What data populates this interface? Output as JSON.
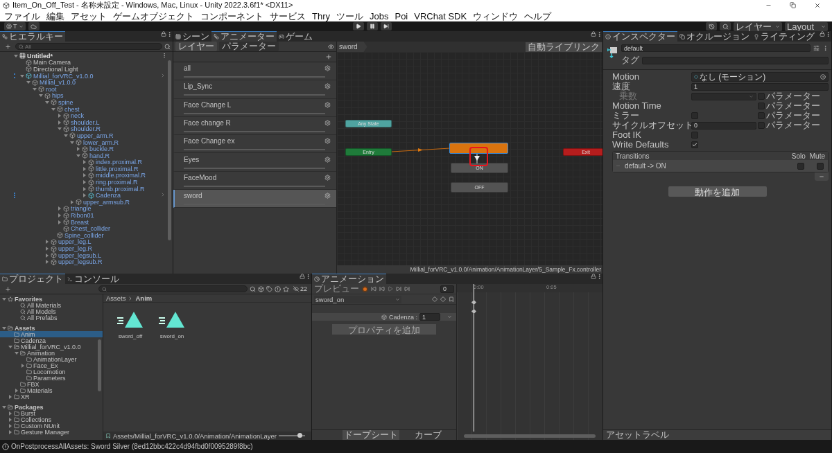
{
  "window": {
    "title": "Item_On_Off_Test - 名称未設定 - Windows, Mac, Linux - Unity 2022.3.6f1* <DX11>"
  },
  "menu": [
    "ファイル",
    "編集",
    "アセット",
    "ゲームオブジェクト",
    "コンポーネント",
    "サービス",
    "Thry",
    "ツール",
    "Jobs",
    "Poi",
    "VRChat SDK",
    "ウィンドウ",
    "ヘルプ"
  ],
  "toolbar": {
    "account": "T",
    "layers": "レイヤー",
    "layout": "Layout"
  },
  "hierarchy": {
    "tab": "ヒエラルキー",
    "search": {
      "placeholder": "All"
    },
    "items": [
      {
        "name": "Untitled*",
        "kind": "scene",
        "expanded": true,
        "prefab": false,
        "selected": false,
        "children": [
          {
            "name": "Main Camera",
            "kind": "object",
            "prefab": false,
            "selected": false
          },
          {
            "name": "Directional Light",
            "kind": "object",
            "prefab": false,
            "selected": false
          },
          {
            "name": "Millial_forVRC_v1.0.0",
            "kind": "prefab-root",
            "expanded": true,
            "prefab": true,
            "selected": false,
            "children": [
              {
                "name": "Millial_v1.0.0",
                "kind": "object",
                "expanded": true,
                "prefab": true,
                "selected": false,
                "children": [
                  {
                    "name": "root",
                    "kind": "object",
                    "expanded": true,
                    "prefab": true,
                    "selected": false,
                    "children": [
                      {
                        "name": "hips",
                        "kind": "object",
                        "expanded": true,
                        "prefab": true,
                        "selected": false,
                        "children": [
                          {
                            "name": "spine",
                            "kind": "object",
                            "expanded": true,
                            "prefab": true,
                            "selected": false,
                            "children": [
                              {
                                "name": "chest",
                                "kind": "object",
                                "expanded": true,
                                "prefab": true,
                                "selected": false,
                                "children": [
                                  {
                                    "name": "neck",
                                    "kind": "object",
                                    "expanded": false,
                                    "prefab": true,
                                    "selected": false
                                  },
                                  {
                                    "name": "shoulder.L",
                                    "kind": "object",
                                    "expanded": false,
                                    "prefab": true,
                                    "selected": false
                                  },
                                  {
                                    "name": "shoulder.R",
                                    "kind": "object",
                                    "expanded": true,
                                    "prefab": true,
                                    "selected": false,
                                    "children": [
                                      {
                                        "name": "upper_arm.R",
                                        "kind": "object",
                                        "expanded": true,
                                        "prefab": true,
                                        "selected": false,
                                        "children": [
                                          {
                                            "name": "lower_arm.R",
                                            "kind": "object",
                                            "expanded": true,
                                            "prefab": true,
                                            "selected": false,
                                            "children": [
                                              {
                                                "name": "buckle.R",
                                                "kind": "object",
                                                "expanded": false,
                                                "prefab": true,
                                                "selected": false
                                              },
                                              {
                                                "name": "hand.R",
                                                "kind": "object",
                                                "expanded": true,
                                                "prefab": true,
                                                "selected": false,
                                                "children": [
                                                  {
                                                    "name": "index.proximal.R",
                                                    "kind": "object",
                                                    "expanded": false,
                                                    "prefab": true,
                                                    "selected": false
                                                  },
                                                  {
                                                    "name": "little.proximal.R",
                                                    "kind": "object",
                                                    "expanded": false,
                                                    "prefab": true,
                                                    "selected": false
                                                  },
                                                  {
                                                    "name": "middle.proximal.R",
                                                    "kind": "object",
                                                    "expanded": false,
                                                    "prefab": true,
                                                    "selected": false
                                                  },
                                                  {
                                                    "name": "ring.proximal.R",
                                                    "kind": "object",
                                                    "expanded": false,
                                                    "prefab": true,
                                                    "selected": false
                                                  },
                                                  {
                                                    "name": "thumb.proximal.R",
                                                    "kind": "object",
                                                    "expanded": false,
                                                    "prefab": true,
                                                    "selected": false
                                                  },
                                                  {
                                                    "name": "Cadenza",
                                                    "kind": "prefab-root",
                                                    "expanded": false,
                                                    "prefab": true,
                                                    "selected": false
                                                  }
                                                ]
                                              }
                                            ]
                                          },
                                          {
                                            "name": "upper_armsub.R",
                                            "kind": "object",
                                            "expanded": false,
                                            "prefab": true,
                                            "selected": false
                                          }
                                        ]
                                      }
                                    ]
                                  },
                                  {
                                    "name": "triangle",
                                    "kind": "object",
                                    "expanded": false,
                                    "prefab": true,
                                    "selected": false
                                  },
                                  {
                                    "name": "Ribon01",
                                    "kind": "object",
                                    "expanded": false,
                                    "prefab": true,
                                    "selected": false
                                  },
                                  {
                                    "name": "Breast",
                                    "kind": "object",
                                    "expanded": false,
                                    "prefab": true,
                                    "selected": false
                                  },
                                  {
                                    "name": "Chest_collider",
                                    "kind": "object",
                                    "prefab": true,
                                    "selected": false
                                  }
                                ]
                              },
                              {
                                "name": "Spine_collider",
                                "kind": "object",
                                "prefab": true,
                                "selected": false
                              }
                            ]
                          },
                          {
                            "name": "upper_leg.L",
                            "kind": "object",
                            "expanded": false,
                            "prefab": true,
                            "selected": false
                          },
                          {
                            "name": "upper_leg.R",
                            "kind": "object",
                            "expanded": false,
                            "prefab": true,
                            "selected": false
                          },
                          {
                            "name": "upper_legsub.L",
                            "kind": "object",
                            "expanded": false,
                            "prefab": true,
                            "selected": false
                          },
                          {
                            "name": "upper_legsub.R",
                            "kind": "object",
                            "expanded": false,
                            "prefab": true,
                            "selected": false
                          }
                        ]
                      }
                    ]
                  }
                ]
              }
            ]
          }
        ]
      }
    ]
  },
  "animator": {
    "tabs": [
      {
        "label": "シーン",
        "kind": "scene",
        "selected": false
      },
      {
        "label": "アニメーター",
        "kind": "animator",
        "selected": true
      },
      {
        "label": "ゲーム",
        "kind": "game",
        "selected": false
      }
    ],
    "subtabs": [
      {
        "label": "レイヤー",
        "selected": true
      },
      {
        "label": "パラメーター",
        "selected": false
      }
    ],
    "layers": [
      {
        "name": "all",
        "selected": false
      },
      {
        "name": "Lip_Sync",
        "selected": false
      },
      {
        "name": "Face Change L",
        "selected": false
      },
      {
        "name": "Face change R",
        "selected": false
      },
      {
        "name": "Face Change ex",
        "selected": false
      },
      {
        "name": "Eyes",
        "selected": false
      },
      {
        "name": "FaceMood",
        "selected": false
      },
      {
        "name": "sword",
        "selected": true
      }
    ],
    "breadcrumb": "sword",
    "live_link": "自動ライブリンク",
    "nodes": [
      {
        "kind": "any",
        "label": "Any State"
      },
      {
        "kind": "entry",
        "label": "Entry"
      },
      {
        "kind": "default"
      },
      {
        "kind": "state",
        "label": "ON"
      },
      {
        "kind": "state",
        "label": "OFF"
      },
      {
        "kind": "exit",
        "label": "Exit"
      }
    ],
    "path": "Millial_forVRC_v1.0.0/Animation/AnimationLayer/5_Sample_Fx.controller"
  },
  "inspector": {
    "tabs": [
      {
        "label": "インスペクター",
        "kind": "info",
        "selected": true
      },
      {
        "label": "オクルージョン",
        "kind": "occlusion",
        "selected": false
      },
      {
        "label": "ライティング",
        "kind": "light",
        "selected": false
      }
    ],
    "name": "default",
    "tag_label": "タグ",
    "properties": [
      {
        "kind": "object",
        "label": "Motion",
        "value": "なし (モーション)",
        "disabled": false
      },
      {
        "kind": "number",
        "label": "速度",
        "value": "1",
        "disabled": false
      },
      {
        "kind": "dropdown",
        "label": "乗数",
        "disabled": true,
        "param": {
          "label": "パラメーター",
          "checked": false
        }
      },
      {
        "kind": "empty",
        "label": "Motion Time",
        "disabled": false,
        "param": {
          "label": "パラメーター",
          "checked": false
        }
      },
      {
        "kind": "checkbox",
        "label": "ミラー",
        "checked": false,
        "disabled": false,
        "param": {
          "label": "パラメーター",
          "checked": false
        }
      },
      {
        "kind": "number",
        "label": "サイクルオフセット",
        "value": "0",
        "disabled": false,
        "param": {
          "label": "パラメーター",
          "checked": false
        }
      },
      {
        "kind": "checkbox",
        "label": "Foot IK",
        "checked": false,
        "disabled": false
      },
      {
        "kind": "checkbox",
        "label": "Write Defaults",
        "checked": true,
        "disabled": false
      }
    ],
    "transitions": {
      "title": "Transitions",
      "solo": "Solo",
      "mute": "Mute",
      "rows": [
        {
          "label": "default -> ON",
          "solo": false,
          "mute": false
        }
      ]
    },
    "add_button": "動作を追加",
    "asset_labels": "アセットラベル"
  },
  "project": {
    "tabs": [
      {
        "label": "プロジェクト",
        "kind": "folder",
        "selected": true
      },
      {
        "label": "コンソール",
        "kind": "console",
        "selected": false
      }
    ],
    "hidden_count": "22",
    "tree": [
      {
        "name": "Favorites",
        "kind": "favorites",
        "expanded": true,
        "selected": false,
        "children": [
          {
            "name": "All Materials",
            "kind": "search",
            "selected": false
          },
          {
            "name": "All Models",
            "kind": "search",
            "selected": false
          },
          {
            "name": "All Prefabs",
            "kind": "search",
            "selected": false
          }
        ]
      },
      {
        "name": "Assets",
        "kind": "folder-open",
        "expanded": true,
        "selected": false,
        "children": [
          {
            "name": "Anim",
            "kind": "folder",
            "selected": true
          },
          {
            "name": "Cadenza",
            "kind": "folder",
            "selected": false
          },
          {
            "name": "Millial_forVRC_v1.0.0",
            "kind": "folder-open",
            "expanded": true,
            "selected": false,
            "children": [
              {
                "name": "Animation",
                "kind": "folder-open",
                "expanded": true,
                "selected": false,
                "children": [
                  {
                    "name": "AnimationLayer",
                    "kind": "folder",
                    "selected": false
                  },
                  {
                    "name": "Face_Ex",
                    "kind": "folder",
                    "expanded": false,
                    "selected": false
                  },
                  {
                    "name": "Locomotion",
                    "kind": "folder",
                    "selected": false
                  },
                  {
                    "name": "Parameters",
                    "kind": "folder",
                    "selected": false
                  }
                ]
              },
              {
                "name": "FBX",
                "kind": "folder",
                "selected": false
              },
              {
                "name": "Materials",
                "kind": "folder",
                "expanded": false,
                "selected": false
              }
            ]
          },
          {
            "name": "XR",
            "kind": "folder",
            "expanded": false,
            "selected": false
          }
        ]
      },
      {
        "name": "Packages",
        "kind": "folder-open",
        "expanded": true,
        "selected": false,
        "children": [
          {
            "name": "Burst",
            "kind": "folder",
            "expanded": false,
            "selected": false
          },
          {
            "name": "Collections",
            "kind": "folder",
            "expanded": false,
            "selected": false
          },
          {
            "name": "Custom NUnit",
            "kind": "folder",
            "expanded": false,
            "selected": false
          },
          {
            "name": "Gesture Manager",
            "kind": "folder",
            "expanded": false,
            "selected": false
          }
        ]
      }
    ],
    "breadcrumb": [
      "Assets",
      "Anim"
    ],
    "assets": [
      {
        "name": "sword_off"
      },
      {
        "name": "sword_on"
      }
    ],
    "path": "Assets/Millial_forVRC_v1.0.0/Animation/AnimationLayer",
    "zoom": {
      "level": 0.8
    }
  },
  "animation": {
    "tab": "アニメーション",
    "preview": "プレビュー",
    "frame": "0",
    "clip": "sword_on",
    "properties": [
      {
        "name": "Cadenza :",
        "value": "1"
      }
    ],
    "add_property": "プロパティを追加",
    "modes": [
      {
        "label": "ドープシート",
        "selected": true
      },
      {
        "label": "カーブ",
        "selected": false
      }
    ],
    "ruler": [
      "0:00",
      "0:05"
    ]
  },
  "status": "OnPostprocessAllAssets: Sword Silver (8ed12bbc422c4d94fbd0f0095289f8bc)"
}
